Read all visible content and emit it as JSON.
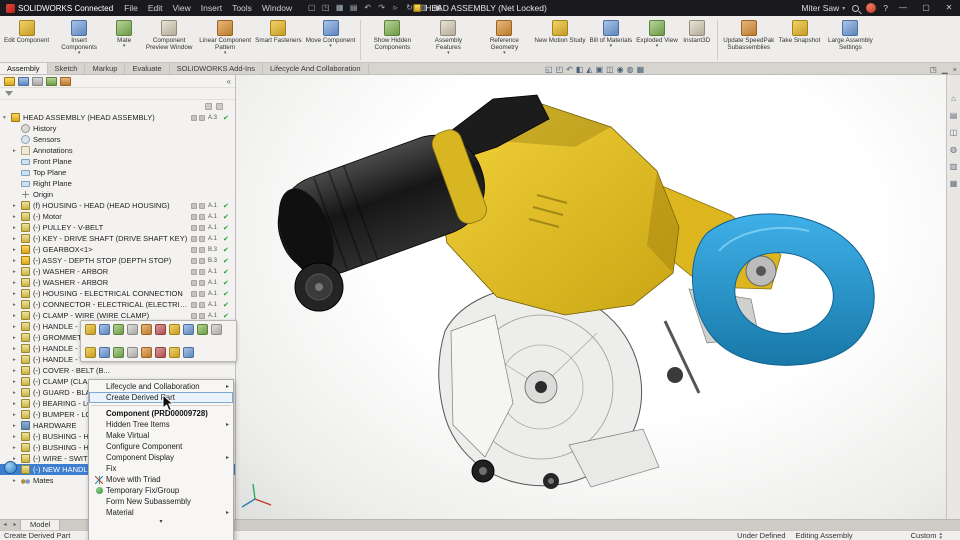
{
  "titlebar": {
    "app": "SOLIDWORKS Connected",
    "menus": [
      "File",
      "Edit",
      "View",
      "Insert",
      "Tools",
      "Window"
    ],
    "doc_title": "HEAD ASSEMBLY (Net Locked)",
    "profile": "Miter Saw",
    "caret": "▾",
    "help": "?",
    "minimize": "—",
    "maximize": "▢",
    "close": "✕",
    "quickbar": [
      {
        "name": "new-file-icon",
        "g": "▢"
      },
      {
        "name": "open-file-icon",
        "g": "◳"
      },
      {
        "name": "save-icon",
        "g": "▦"
      },
      {
        "name": "print-icon",
        "g": "▤"
      },
      {
        "name": "undo-icon",
        "g": "↶"
      },
      {
        "name": "redo-icon",
        "g": "↷"
      },
      {
        "name": "select-icon",
        "g": "▹"
      },
      {
        "name": "rebuild-icon",
        "g": "↻"
      },
      {
        "name": "file-properties-icon",
        "g": "▥"
      },
      {
        "name": "options-icon",
        "g": "▣"
      }
    ]
  },
  "ribbon": {
    "arrow_glyph": "▾",
    "buttons": [
      {
        "label": "Edit Component"
      },
      {
        "label": "Insert Components",
        "arrow": true
      },
      {
        "label": "Mate",
        "arrow": true
      },
      {
        "label": "Component Preview Window"
      },
      {
        "label": "Linear Component Pattern",
        "arrow": true
      },
      {
        "label": "Smart Fasteners"
      },
      {
        "label": "Move Component",
        "arrow": true,
        "sep": true
      },
      {
        "label": "Show Hidden Components"
      },
      {
        "label": "Assembly Features",
        "arrow": true
      },
      {
        "label": "Reference Geometry",
        "arrow": true
      },
      {
        "label": "New Motion Study"
      },
      {
        "label": "Bill of Materials",
        "arrow": true
      },
      {
        "label": "Exploded View",
        "arrow": true
      },
      {
        "label": "Instant3D",
        "sep": true
      },
      {
        "label": "Update SpeedPak Subassemblies"
      },
      {
        "label": "Take Snapshot"
      },
      {
        "label": "Large Assembly Settings"
      }
    ],
    "tabs": [
      {
        "label": "Assembly",
        "active": true
      },
      {
        "label": "Sketch"
      },
      {
        "label": "Markup"
      },
      {
        "label": "Evaluate"
      },
      {
        "label": "SOLIDWORKS Add-Ins"
      },
      {
        "label": "Lifecycle And Collaboration"
      }
    ]
  },
  "viewport": {
    "hud": [
      {
        "name": "zoom-fit-icon",
        "g": "◱"
      },
      {
        "name": "zoom-area-icon",
        "g": "◰"
      },
      {
        "name": "previous-view-icon",
        "g": "↶"
      },
      {
        "name": "section-view-icon",
        "g": "◧"
      },
      {
        "name": "annotation-views-icon",
        "g": "◭"
      },
      {
        "name": "view-orientation-icon",
        "g": "▣"
      },
      {
        "name": "display-style-icon",
        "g": "◫"
      },
      {
        "name": "hide-show-items-icon",
        "g": "◉"
      },
      {
        "name": "edit-appearance-icon",
        "g": "◍"
      },
      {
        "name": "apply-scene-icon",
        "g": "▦"
      }
    ],
    "window_icons": [
      {
        "name": "restore-document-icon",
        "g": "◳"
      },
      {
        "name": "minimize-document-icon",
        "g": "▁"
      },
      {
        "name": "close-document-icon",
        "g": "×"
      }
    ]
  },
  "taskpane": [
    {
      "name": "home-icon",
      "g": "⌂"
    },
    {
      "name": "design-library-icon",
      "g": "▤"
    },
    {
      "name": "file-explorer-icon",
      "g": "◫"
    },
    {
      "name": "appearances-icon",
      "g": "◍"
    },
    {
      "name": "custom-properties-icon",
      "g": "▥"
    },
    {
      "name": "forum-icon",
      "g": "▦"
    }
  ],
  "tree": {
    "expand_open": "▾",
    "expand_closed": "▸",
    "check_glyph": "✔",
    "fm_chevron": "«",
    "items": [
      {
        "label": "HEAD ASSEMBLY (HEAD ASSEMBLY)",
        "type": "assembly",
        "expand": "open",
        "ver": "A.3",
        "check": true
      },
      {
        "label": "History",
        "type": "history",
        "indent": 1
      },
      {
        "label": "Sensors",
        "type": "sensors",
        "indent": 1
      },
      {
        "label": "Annotations",
        "type": "annotations",
        "indent": 1,
        "expand": "closed"
      },
      {
        "label": "Front Plane",
        "type": "plane",
        "indent": 1
      },
      {
        "label": "Top Plane",
        "type": "plane",
        "indent": 1
      },
      {
        "label": "Right Plane",
        "type": "plane",
        "indent": 1
      },
      {
        "label": "Origin",
        "type": "origin",
        "indent": 1
      },
      {
        "label": "(f) HOUSING - HEAD (HEAD HOUSING)",
        "type": "part",
        "indent": 1,
        "expand": "closed",
        "ver": "A.1",
        "check": true
      },
      {
        "label": "(-) Motor",
        "type": "part",
        "indent": 1,
        "expand": "closed",
        "ver": "A.1",
        "check": true
      },
      {
        "label": "(-) PULLEY - V-BELT",
        "type": "part",
        "indent": 1,
        "expand": "closed",
        "ver": "A.1",
        "check": true
      },
      {
        "label": "(-) KEY - DRIVE SHAFT (DRIVE SHAFT KEY)",
        "type": "part",
        "indent": 1,
        "expand": "closed",
        "ver": "A.1",
        "check": true
      },
      {
        "label": "(-) GEARBOX<1>",
        "type": "assembly",
        "indent": 1,
        "expand": "closed",
        "ver": "B.3",
        "check": true
      },
      {
        "label": "(-) ASSY - DEPTH STOP (DEPTH STOP)",
        "type": "assembly",
        "indent": 1,
        "expand": "closed",
        "ver": "B.3",
        "check": true
      },
      {
        "label": "(-) WASHER - ARBOR",
        "type": "part",
        "indent": 1,
        "expand": "closed",
        "ver": "A.1",
        "check": true
      },
      {
        "label": "(-) WASHER - ARBOR",
        "type": "part",
        "indent": 1,
        "expand": "closed",
        "ver": "A.1",
        "check": true
      },
      {
        "label": "(-) HOUSING - ELECTRICAL CONNECTION",
        "type": "part",
        "indent": 1,
        "expand": "closed",
        "ver": "A.1",
        "check": true
      },
      {
        "label": "(-) CONNECTOR - ELECTRICAL (ELECTRICA...",
        "type": "part",
        "indent": 1,
        "expand": "closed",
        "ver": "A.1",
        "check": true
      },
      {
        "label": "(-) CLAMP - WIRE (WIRE CLAMP)",
        "type": "part",
        "indent": 1,
        "expand": "closed",
        "ver": "A.1",
        "check": true
      },
      {
        "label": "(-) HANDLE - HEAD...",
        "type": "part",
        "indent": 1,
        "expand": "closed"
      },
      {
        "label": "(-) GROMMET - WIR...",
        "type": "part",
        "indent": 1,
        "expand": "closed"
      },
      {
        "label": "(-) HANDLE - TRIGG...",
        "type": "part",
        "indent": 1,
        "expand": "closed"
      },
      {
        "label": "(-) HANDLE - TRIGG...",
        "type": "part",
        "indent": 1,
        "expand": "closed"
      },
      {
        "label": "(-) COVER - BELT (B...",
        "type": "part",
        "indent": 1,
        "expand": "closed"
      },
      {
        "label": "(-) CLAMP (CLAMP...",
        "type": "part",
        "indent": 1,
        "expand": "closed"
      },
      {
        "label": "(-) GUARD - BLADE...",
        "type": "part",
        "indent": 1,
        "expand": "closed"
      },
      {
        "label": "(-) BEARING - LOWE...",
        "type": "part",
        "indent": 1,
        "expand": "closed"
      },
      {
        "label": "(-) BUMPER - LOW...",
        "type": "part",
        "indent": 1,
        "expand": "closed"
      },
      {
        "label": "HARDWARE",
        "type": "folder",
        "indent": 1,
        "expand": "closed"
      },
      {
        "label": "(-) BUSHING - HEAD...",
        "type": "part",
        "indent": 1,
        "expand": "closed"
      },
      {
        "label": "(-) BUSHING - HEA...",
        "type": "part",
        "indent": 1,
        "expand": "closed"
      },
      {
        "label": "(-) WIRE - SWITCH T...",
        "type": "part",
        "indent": 1,
        "expand": "closed"
      },
      {
        "label": "(-) NEW HANDLE (x...",
        "type": "part",
        "indent": 1,
        "expand": "closed",
        "selected": true
      },
      {
        "label": "Mates",
        "type": "mates",
        "indent": 1,
        "expand": "closed"
      }
    ]
  },
  "context_menu": {
    "submenu_glyph": "▸",
    "more_glyph": "▾",
    "toolbar_row1": [
      {
        "name": "edit-component-icon"
      },
      {
        "name": "open-part-icon"
      },
      {
        "name": "mate-icon"
      },
      {
        "name": "move-with-triad-icon"
      },
      {
        "name": "hide-component-icon"
      },
      {
        "name": "suppress-icon"
      },
      {
        "name": "fix-icon"
      },
      {
        "name": "appearance-icon"
      },
      {
        "name": "delete-icon"
      },
      {
        "name": "isolate-icon"
      }
    ],
    "toolbar_row2": [
      {
        "name": "zoom-to-selection-icon"
      },
      {
        "name": "configure-component-icon"
      },
      {
        "name": "lock-icon"
      },
      {
        "name": "comment-icon"
      },
      {
        "name": "pack-and-go-icon"
      },
      {
        "name": "properties-icon"
      },
      {
        "name": "select-other-icon"
      },
      {
        "name": "help-icon"
      }
    ],
    "items": [
      {
        "label": "Lifecycle and Collaboration",
        "submenu": true
      },
      {
        "label": "Create Derived Part",
        "highlight": true
      },
      {
        "separator": true
      },
      {
        "label": "Component (PRD00009728)",
        "header": true
      },
      {
        "label": "Hidden Tree Items",
        "submenu": true
      },
      {
        "label": "Make Virtual"
      },
      {
        "label": "Configure Component"
      },
      {
        "label": "Component Display",
        "submenu": true
      },
      {
        "label": "Fix"
      },
      {
        "label": "Move with Triad",
        "icon": "triad"
      },
      {
        "label": "Temporary Fix/Group",
        "icon": "pin"
      },
      {
        "label": "Form New Subassembly"
      },
      {
        "label": "Material",
        "submenu": true
      }
    ]
  },
  "model_tabs": {
    "nav_prev": "◂",
    "nav_next": "▸",
    "tabs": [
      "Model"
    ]
  },
  "statusbar": {
    "activity": "Create Derived Part",
    "defined_state": "Under Defined",
    "mode": "Editing Assembly",
    "units": "Custom",
    "spin_up": "▴",
    "spin_down": "▾"
  }
}
